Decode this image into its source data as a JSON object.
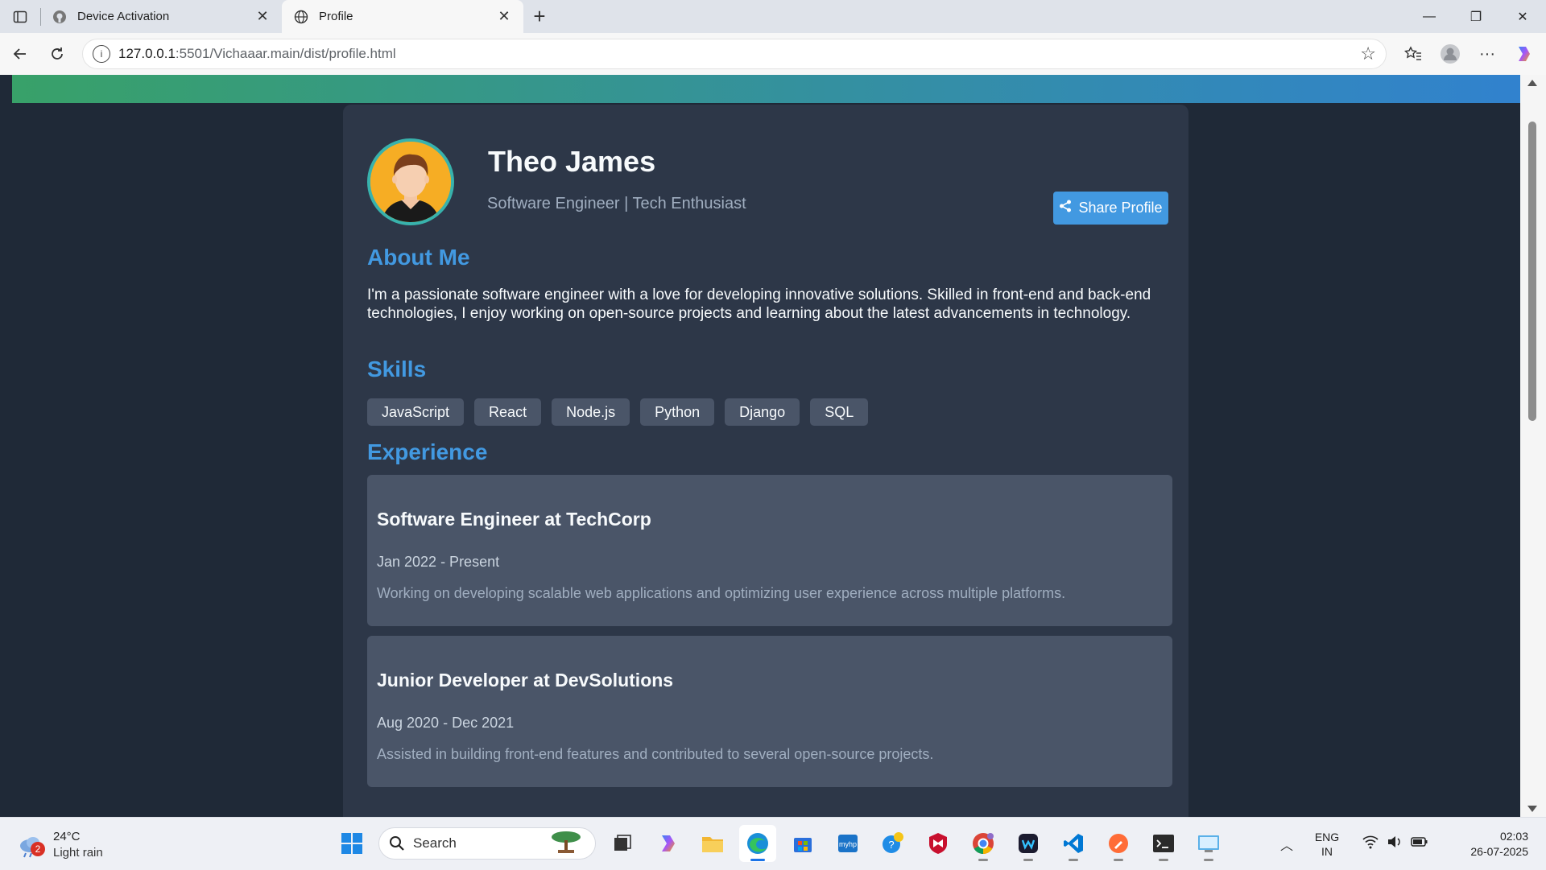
{
  "browser": {
    "tabs": [
      {
        "title": "Device Activation",
        "favicon": "github-icon",
        "active": false
      },
      {
        "title": "Profile",
        "favicon": "globe-icon",
        "active": true
      }
    ],
    "url_host": "127.0.0.1",
    "url_path": ":5501/Vichaaar.main/dist/profile.html"
  },
  "profile": {
    "name": "Theo James",
    "tagline": "Software Engineer | Tech Enthusiast",
    "share_label": "Share Profile",
    "about_title": "About Me",
    "about_text": "I'm a passionate software engineer with a love for developing innovative solutions. Skilled in front-end and back-end technologies, I enjoy working on open-source projects and learning about the latest advancements in technology.",
    "skills_title": "Skills",
    "skills": [
      "JavaScript",
      "React",
      "Node.js",
      "Python",
      "Django",
      "SQL"
    ],
    "experience_title": "Experience",
    "experience": [
      {
        "role": "Software Engineer at TechCorp",
        "dates": "Jan 2022 - Present",
        "desc": "Working on developing scalable web applications and optimizing user experience across multiple platforms."
      },
      {
        "role": "Junior Developer at DevSolutions",
        "dates": "Aug 2020 - Dec 2021",
        "desc": "Assisted in building front-end features and contributed to several open-source projects."
      }
    ]
  },
  "taskbar": {
    "weather_temp": "24°C",
    "weather_desc": "Light rain",
    "weather_badge": "2",
    "search_label": "Search",
    "lang_line1": "ENG",
    "lang_line2": "IN",
    "time": "02:03",
    "date": "26-07-2025"
  },
  "colors": {
    "page_bg": "#1f2937",
    "card_bg": "#2d3748",
    "accent": "#4299e1",
    "banner_from": "#38a169",
    "banner_to": "#3182ce"
  }
}
